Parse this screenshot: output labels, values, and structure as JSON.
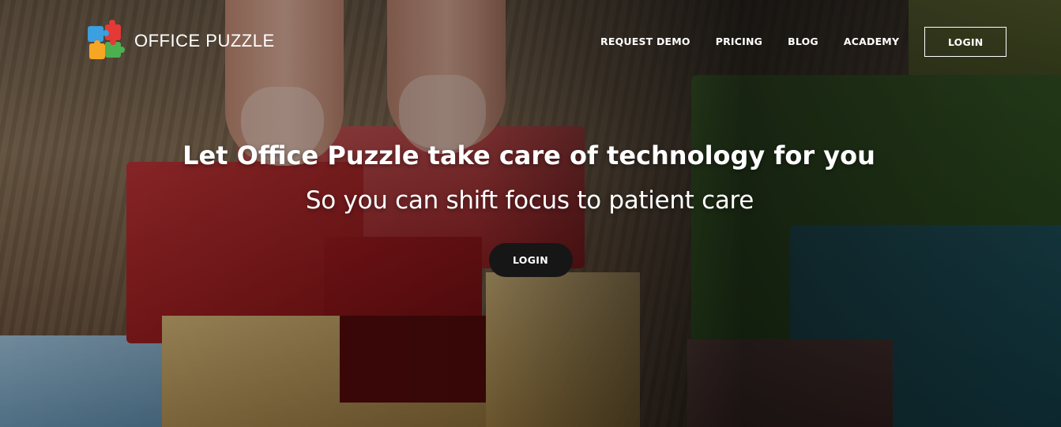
{
  "brand": {
    "name": "OFFICE PUZZLE",
    "logo_icon": "puzzle-pieces-icon",
    "logo_colors": [
      "#3b9fe0",
      "#e53935",
      "#f5a623",
      "#4caf50"
    ]
  },
  "nav": {
    "items": [
      {
        "label": "REQUEST DEMO"
      },
      {
        "label": "PRICING"
      },
      {
        "label": "BLOG"
      },
      {
        "label": "ACADEMY"
      }
    ],
    "login_label": "LOGIN"
  },
  "hero": {
    "title": "Let Office Puzzle take care of technology for you",
    "subtitle": "So you can shift focus to patient care",
    "cta_label": "LOGIN",
    "background": "wooden puzzle blocks photo"
  },
  "colors": {
    "text": "#ffffff",
    "cta_background": "#161616"
  }
}
